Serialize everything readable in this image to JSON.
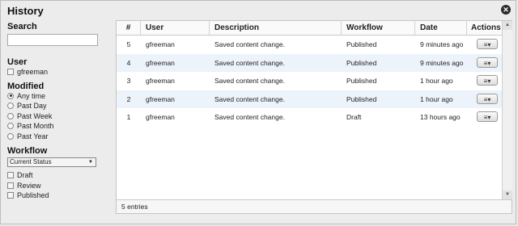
{
  "dialog": {
    "title": "History",
    "close_glyph": "✕",
    "close_icon": "close-icon"
  },
  "sidebar": {
    "search": {
      "heading": "Search",
      "value": "",
      "placeholder": ""
    },
    "user": {
      "heading": "User",
      "options": [
        {
          "label": "gfreeman",
          "checked": false
        }
      ]
    },
    "modified": {
      "heading": "Modified",
      "options": [
        {
          "label": "Any time",
          "selected": true
        },
        {
          "label": "Past Day",
          "selected": false
        },
        {
          "label": "Past Week",
          "selected": false
        },
        {
          "label": "Past Month",
          "selected": false
        },
        {
          "label": "Past Year",
          "selected": false
        }
      ]
    },
    "workflow": {
      "heading": "Workflow",
      "select_value": "Current Status",
      "options": [
        {
          "label": "Draft",
          "checked": false
        },
        {
          "label": "Review",
          "checked": false
        },
        {
          "label": "Published",
          "checked": false
        }
      ]
    }
  },
  "table": {
    "columns": [
      "#",
      "User",
      "Description",
      "Workflow",
      "Date",
      "Actions"
    ],
    "rows": [
      {
        "num": "5",
        "user": "gfreeman",
        "description": "Saved content change.",
        "workflow": "Published",
        "date": "9 minutes ago"
      },
      {
        "num": "4",
        "user": "gfreeman",
        "description": "Saved content change.",
        "workflow": "Published",
        "date": "9 minutes ago"
      },
      {
        "num": "3",
        "user": "gfreeman",
        "description": "Saved content change.",
        "workflow": "Published",
        "date": "1 hour ago"
      },
      {
        "num": "2",
        "user": "gfreeman",
        "description": "Saved content change.",
        "workflow": "Published",
        "date": "1 hour ago"
      },
      {
        "num": "1",
        "user": "gfreeman",
        "description": "Saved content change.",
        "workflow": "Draft",
        "date": "13 hours ago"
      }
    ],
    "action_glyph": "≡▾",
    "footer": "5 entries"
  },
  "colors": {
    "row_alt": "#edf3fa",
    "panel_bg": "#ffffff",
    "dialog_bg": "#ececec"
  }
}
